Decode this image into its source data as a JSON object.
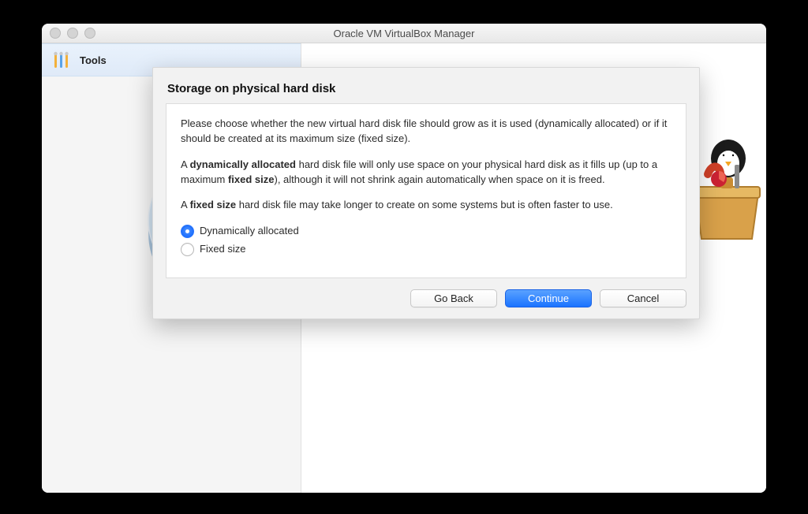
{
  "window": {
    "title": "Oracle VM VirtualBox Manager"
  },
  "sidebar": {
    "tools_label": "Tools"
  },
  "dialog": {
    "heading": "Storage on physical hard disk",
    "para1": "Please choose whether the new virtual hard disk file should grow as it is used (dynamically allocated) or if it should be created at its maximum size (fixed size).",
    "para2_prefix": "A ",
    "para2_bold1": "dynamically allocated",
    "para2_mid": " hard disk file will only use space on your physical hard disk as it fills up (up to a maximum ",
    "para2_bold2": "fixed size",
    "para2_suffix": "), although it will not shrink again automatically when space on it is freed.",
    "para3_prefix": "A ",
    "para3_bold": "fixed size",
    "para3_suffix": " hard disk file may take longer to create on some systems but is often faster to use.",
    "radio1_label": "Dynamically allocated",
    "radio2_label": "Fixed size",
    "selected_option": "dynamic",
    "go_back": "Go Back",
    "continue": "Continue",
    "cancel": "Cancel"
  },
  "icons": {
    "tools": "tools-icon",
    "mascot": "penguin-toolbox-icon",
    "pie": "pie-chart-icon"
  },
  "colors": {
    "accent": "#1d6fff",
    "window_bg": "#ececec",
    "sidebar_selected": "#e4eefb"
  }
}
